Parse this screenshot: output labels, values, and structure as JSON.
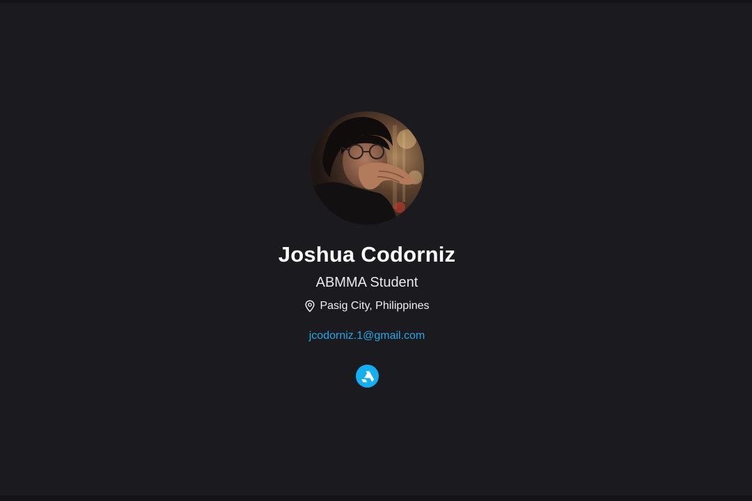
{
  "profile": {
    "name": "Joshua Codorniz",
    "role": "ABMMA Student",
    "location": "Pasig City, Philippines",
    "email": "jcodorniz.1@gmail.com",
    "avatar_icon": "profile-photo",
    "location_icon": "map-pin-icon"
  },
  "social": {
    "links": [
      {
        "icon": "artstation-icon",
        "color": "#13aff0"
      }
    ]
  },
  "colors": {
    "background": "#1a1a1f",
    "link": "#26a7e6",
    "accent": "#13aff0"
  }
}
